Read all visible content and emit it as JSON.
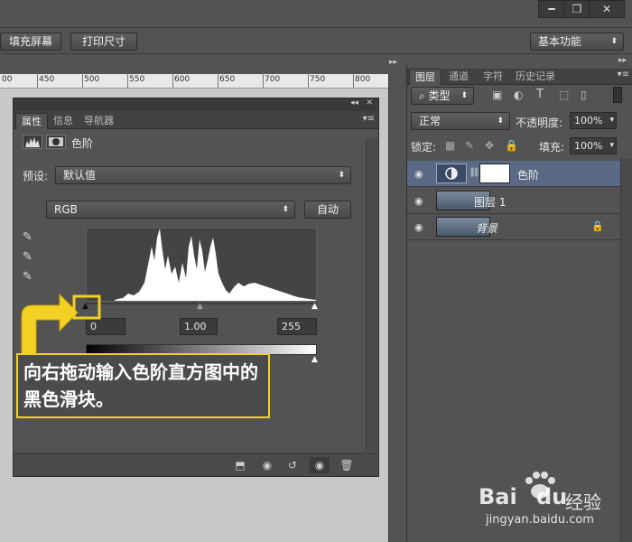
{
  "window_controls": {
    "minimize": "━",
    "restore": "❐",
    "close": "✕"
  },
  "options_bar": {
    "fill_screen": "填充屏幕",
    "print_size": "打印尺寸",
    "workspace": "基本功能"
  },
  "ruler": {
    "ticks": [
      "00",
      "450",
      "500",
      "550",
      "600",
      "650",
      "700",
      "750",
      "800"
    ]
  },
  "properties_panel": {
    "tabs": [
      "属性",
      "信息",
      "导航器"
    ],
    "title": "色阶",
    "preset_label": "预设:",
    "preset_value": "默认值",
    "channel_value": "RGB",
    "auto_button": "自动",
    "input_black": "0",
    "input_mid": "1.00",
    "input_white": "255"
  },
  "callout": {
    "text": "向右拖动输入色阶直方图中的黑色滑块。"
  },
  "layers_panel": {
    "tabs": [
      "图层",
      "通道",
      "字符",
      "历史记录"
    ],
    "filter_kind": "类型",
    "blend_mode": "正常",
    "opacity_label": "不透明度:",
    "opacity_value": "100%",
    "lock_label": "锁定:",
    "fill_label": "填充:",
    "fill_value": "100%",
    "layers": [
      {
        "name": "色阶",
        "type": "adjustment"
      },
      {
        "name": "图层 1",
        "type": "image"
      },
      {
        "name": "背景",
        "type": "background"
      }
    ]
  },
  "watermark": {
    "brand": "Bai",
    "brand2": "du",
    "product": "经验",
    "url": "jingyan.baidu.com"
  },
  "colors": {
    "accent_yellow": "#f2d024",
    "panel_bg": "#535353",
    "selected_layer": "#5a6a85"
  }
}
